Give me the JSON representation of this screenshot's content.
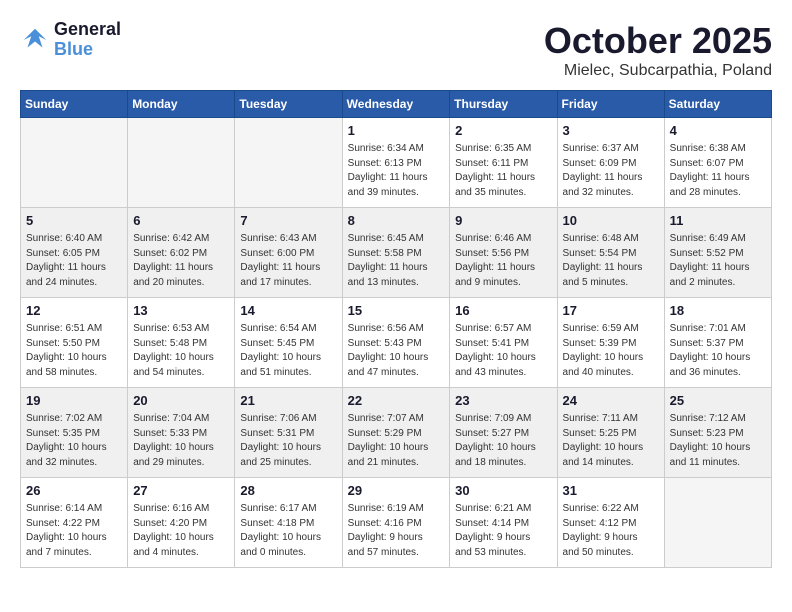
{
  "logo": {
    "line1": "General",
    "line2": "Blue"
  },
  "title": "October 2025",
  "subtitle": "Mielec, Subcarpathia, Poland",
  "days_of_week": [
    "Sunday",
    "Monday",
    "Tuesday",
    "Wednesday",
    "Thursday",
    "Friday",
    "Saturday"
  ],
  "weeks": [
    [
      {
        "day": "",
        "info": ""
      },
      {
        "day": "",
        "info": ""
      },
      {
        "day": "",
        "info": ""
      },
      {
        "day": "1",
        "info": "Sunrise: 6:34 AM\nSunset: 6:13 PM\nDaylight: 11 hours\nand 39 minutes."
      },
      {
        "day": "2",
        "info": "Sunrise: 6:35 AM\nSunset: 6:11 PM\nDaylight: 11 hours\nand 35 minutes."
      },
      {
        "day": "3",
        "info": "Sunrise: 6:37 AM\nSunset: 6:09 PM\nDaylight: 11 hours\nand 32 minutes."
      },
      {
        "day": "4",
        "info": "Sunrise: 6:38 AM\nSunset: 6:07 PM\nDaylight: 11 hours\nand 28 minutes."
      }
    ],
    [
      {
        "day": "5",
        "info": "Sunrise: 6:40 AM\nSunset: 6:05 PM\nDaylight: 11 hours\nand 24 minutes."
      },
      {
        "day": "6",
        "info": "Sunrise: 6:42 AM\nSunset: 6:02 PM\nDaylight: 11 hours\nand 20 minutes."
      },
      {
        "day": "7",
        "info": "Sunrise: 6:43 AM\nSunset: 6:00 PM\nDaylight: 11 hours\nand 17 minutes."
      },
      {
        "day": "8",
        "info": "Sunrise: 6:45 AM\nSunset: 5:58 PM\nDaylight: 11 hours\nand 13 minutes."
      },
      {
        "day": "9",
        "info": "Sunrise: 6:46 AM\nSunset: 5:56 PM\nDaylight: 11 hours\nand 9 minutes."
      },
      {
        "day": "10",
        "info": "Sunrise: 6:48 AM\nSunset: 5:54 PM\nDaylight: 11 hours\nand 5 minutes."
      },
      {
        "day": "11",
        "info": "Sunrise: 6:49 AM\nSunset: 5:52 PM\nDaylight: 11 hours\nand 2 minutes."
      }
    ],
    [
      {
        "day": "12",
        "info": "Sunrise: 6:51 AM\nSunset: 5:50 PM\nDaylight: 10 hours\nand 58 minutes."
      },
      {
        "day": "13",
        "info": "Sunrise: 6:53 AM\nSunset: 5:48 PM\nDaylight: 10 hours\nand 54 minutes."
      },
      {
        "day": "14",
        "info": "Sunrise: 6:54 AM\nSunset: 5:45 PM\nDaylight: 10 hours\nand 51 minutes."
      },
      {
        "day": "15",
        "info": "Sunrise: 6:56 AM\nSunset: 5:43 PM\nDaylight: 10 hours\nand 47 minutes."
      },
      {
        "day": "16",
        "info": "Sunrise: 6:57 AM\nSunset: 5:41 PM\nDaylight: 10 hours\nand 43 minutes."
      },
      {
        "day": "17",
        "info": "Sunrise: 6:59 AM\nSunset: 5:39 PM\nDaylight: 10 hours\nand 40 minutes."
      },
      {
        "day": "18",
        "info": "Sunrise: 7:01 AM\nSunset: 5:37 PM\nDaylight: 10 hours\nand 36 minutes."
      }
    ],
    [
      {
        "day": "19",
        "info": "Sunrise: 7:02 AM\nSunset: 5:35 PM\nDaylight: 10 hours\nand 32 minutes."
      },
      {
        "day": "20",
        "info": "Sunrise: 7:04 AM\nSunset: 5:33 PM\nDaylight: 10 hours\nand 29 minutes."
      },
      {
        "day": "21",
        "info": "Sunrise: 7:06 AM\nSunset: 5:31 PM\nDaylight: 10 hours\nand 25 minutes."
      },
      {
        "day": "22",
        "info": "Sunrise: 7:07 AM\nSunset: 5:29 PM\nDaylight: 10 hours\nand 21 minutes."
      },
      {
        "day": "23",
        "info": "Sunrise: 7:09 AM\nSunset: 5:27 PM\nDaylight: 10 hours\nand 18 minutes."
      },
      {
        "day": "24",
        "info": "Sunrise: 7:11 AM\nSunset: 5:25 PM\nDaylight: 10 hours\nand 14 minutes."
      },
      {
        "day": "25",
        "info": "Sunrise: 7:12 AM\nSunset: 5:23 PM\nDaylight: 10 hours\nand 11 minutes."
      }
    ],
    [
      {
        "day": "26",
        "info": "Sunrise: 6:14 AM\nSunset: 4:22 PM\nDaylight: 10 hours\nand 7 minutes."
      },
      {
        "day": "27",
        "info": "Sunrise: 6:16 AM\nSunset: 4:20 PM\nDaylight: 10 hours\nand 4 minutes."
      },
      {
        "day": "28",
        "info": "Sunrise: 6:17 AM\nSunset: 4:18 PM\nDaylight: 10 hours\nand 0 minutes."
      },
      {
        "day": "29",
        "info": "Sunrise: 6:19 AM\nSunset: 4:16 PM\nDaylight: 9 hours\nand 57 minutes."
      },
      {
        "day": "30",
        "info": "Sunrise: 6:21 AM\nSunset: 4:14 PM\nDaylight: 9 hours\nand 53 minutes."
      },
      {
        "day": "31",
        "info": "Sunrise: 6:22 AM\nSunset: 4:12 PM\nDaylight: 9 hours\nand 50 minutes."
      },
      {
        "day": "",
        "info": ""
      }
    ]
  ]
}
